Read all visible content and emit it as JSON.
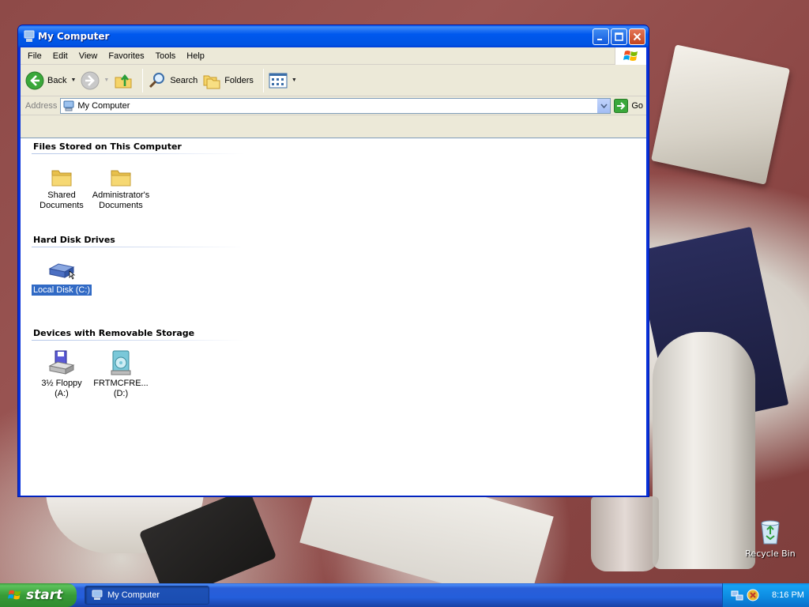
{
  "window": {
    "title": "My Computer",
    "menu": [
      "File",
      "Edit",
      "View",
      "Favorites",
      "Tools",
      "Help"
    ],
    "toolbar": {
      "back_label": "Back",
      "search_label": "Search",
      "folders_label": "Folders"
    },
    "address": {
      "label": "Address",
      "value": "My Computer",
      "go_label": "Go"
    },
    "groups": [
      {
        "header": "Files Stored on This Computer",
        "items": [
          {
            "line1": "Shared",
            "line2": "Documents",
            "icon": "folder-icon"
          },
          {
            "line1": "Administrator's",
            "line2": "Documents",
            "icon": "folder-icon"
          }
        ]
      },
      {
        "header": "Hard Disk Drives",
        "items": [
          {
            "line1": "Local Disk (C:)",
            "icon": "hard-disk-icon",
            "selected": true
          }
        ]
      },
      {
        "header": "Devices with Removable Storage",
        "items": [
          {
            "line1": "3½ Floppy",
            "line2": "(A:)",
            "icon": "floppy-drive-icon"
          },
          {
            "line1": "FRTMCFRE...",
            "line2": "(D:)",
            "icon": "cd-drive-icon"
          }
        ]
      }
    ]
  },
  "desktop": {
    "recycle_bin_label": "Recycle Bin"
  },
  "taskbar": {
    "start_label": "start",
    "task_label": "My Computer",
    "clock": "8:16 PM"
  },
  "colors": {
    "titlebar": "#0054e3",
    "selection": "#316ac5",
    "start_green": "#379c37",
    "taskbar_blue": "#245edb",
    "tray_blue": "#0c8ae0"
  }
}
